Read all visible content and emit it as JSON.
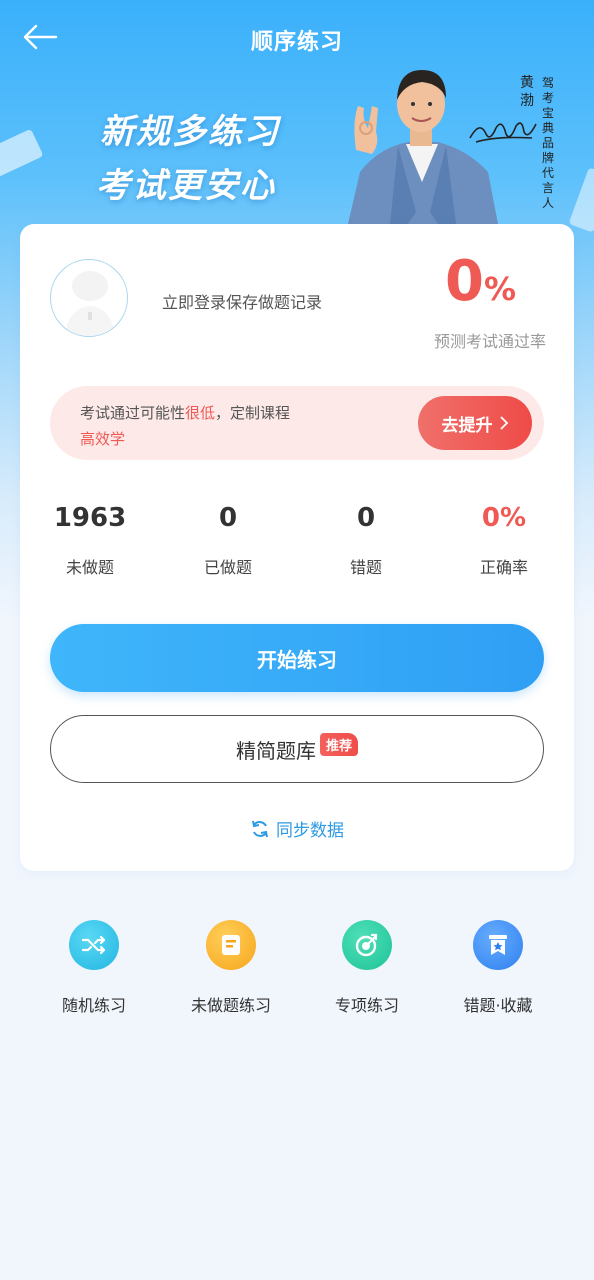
{
  "header": {
    "title": "顺序练习",
    "slogan_line1": "新规多练习",
    "slogan_line2": "考试更安心",
    "spokesperson_name": "黄渤",
    "spokesperson_role": "驾考宝典品牌代言人"
  },
  "profile": {
    "login_prompt": "立即登录保存做题记录",
    "pass_rate_value": "0",
    "pass_rate_unit": "%",
    "pass_rate_label": "预测考试通过率"
  },
  "tip": {
    "text_before": "考试通过可能性",
    "text_highlight": "很低",
    "text_after": "，定制课程",
    "text_line2": "高效学",
    "button_label": "去提升"
  },
  "stats": [
    {
      "value": "1963",
      "label": "未做题"
    },
    {
      "value": "0",
      "label": "已做题"
    },
    {
      "value": "0",
      "label": "错题"
    },
    {
      "value": "0%",
      "label": "正确率"
    }
  ],
  "actions": {
    "start_label": "开始练习",
    "lite_label": "精简题库",
    "lite_badge": "推荐",
    "sync_label": "同步数据"
  },
  "quick_links": [
    {
      "label": "随机练习",
      "icon": "shuffle-icon",
      "color": "#2fc4e8"
    },
    {
      "label": "未做题练习",
      "icon": "document-icon",
      "color": "#fbb129"
    },
    {
      "label": "专项练习",
      "icon": "target-icon",
      "color": "#2ad0a5"
    },
    {
      "label": "错题·收藏",
      "icon": "bookmark-icon",
      "color": "#3e8ff5"
    }
  ],
  "colors": {
    "accent_blue": "#2f9ff4",
    "accent_red": "#ef5a54",
    "tip_bg": "#fde9e8"
  }
}
